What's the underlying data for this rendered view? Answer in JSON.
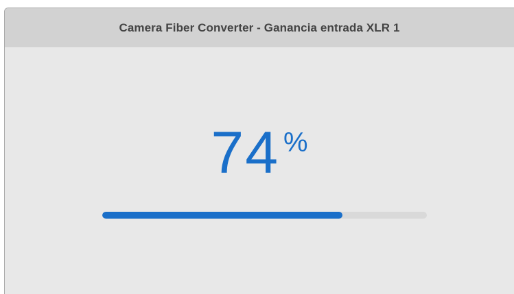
{
  "window": {
    "title": "Camera Fiber Converter - Ganancia entrada XLR 1"
  },
  "gain": {
    "value": "74",
    "unit": "%",
    "level_percent": 74
  },
  "colors": {
    "accent": "#1a6fc9",
    "background": "#e8e8e8",
    "titlebar": "#d2d2d2",
    "track": "#d9d9d9"
  }
}
